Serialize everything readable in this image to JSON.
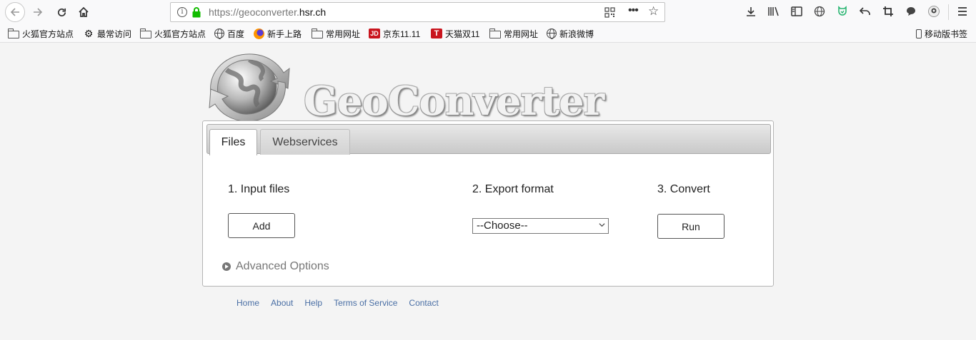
{
  "browser": {
    "url_prefix": "https://geoconverter.",
    "url_domain": "hsr.ch"
  },
  "bookmarks": [
    {
      "label": "火狐官方站点",
      "icon": "folder-icon"
    },
    {
      "label": "最常访问",
      "icon": "gear-icon"
    },
    {
      "label": "火狐官方站点",
      "icon": "folder-icon"
    },
    {
      "label": "百度",
      "icon": "globe-icon"
    },
    {
      "label": "新手上路",
      "icon": "firefox-icon"
    },
    {
      "label": "常用网址",
      "icon": "folder-icon"
    },
    {
      "label": "京东11.11",
      "icon": "jd-icon"
    },
    {
      "label": "天猫双11",
      "icon": "tmall-icon"
    },
    {
      "label": "常用网址",
      "icon": "folder-icon"
    },
    {
      "label": "新浪微博",
      "icon": "globe-icon"
    }
  ],
  "mobile_bookmarks": "移动版书签",
  "icon_badges": {
    "jd": "JD",
    "tmall": "T"
  },
  "logo": {
    "text": "GeoConverter"
  },
  "tabs": {
    "files": "Files",
    "webservices": "Webservices"
  },
  "steps": {
    "input": {
      "title": "1. Input files",
      "button": "Add"
    },
    "export": {
      "title": "2. Export format",
      "selected": "--Choose--"
    },
    "convert": {
      "title": "3. Convert",
      "button": "Run"
    }
  },
  "advanced_options": "Advanced Options",
  "footer_links": [
    "Home",
    "About",
    "Help",
    "Terms of Service",
    "Contact"
  ],
  "colors": {
    "link": "#4a6fa5",
    "secure_lock": "#12bc00"
  }
}
